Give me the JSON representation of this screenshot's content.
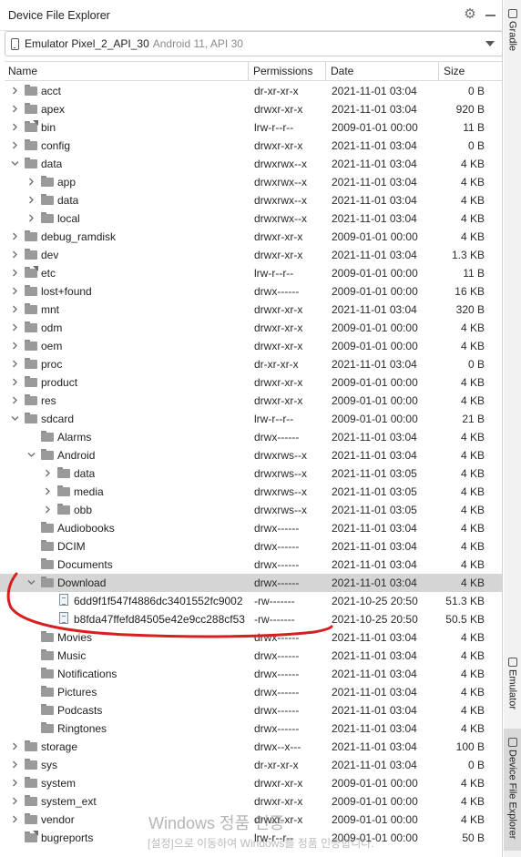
{
  "panel": {
    "title": "Device File Explorer"
  },
  "device": {
    "name": "Emulator Pixel_2_API_30",
    "info": "Android 11, API 30"
  },
  "columns": {
    "name": "Name",
    "permissions": "Permissions",
    "date": "Date",
    "size": "Size"
  },
  "sidebar": {
    "gradle": "Gradle",
    "emulator": "Emulator",
    "device_file_explorer": "Device File Explorer"
  },
  "watermark": {
    "line1": "Windows 정품 인증",
    "line2": "[설정]으로 이동하여 Windows를 정품 인증합니다."
  },
  "rows": [
    {
      "depth": 0,
      "arrow": "right",
      "type": "folder",
      "name": "acct",
      "perm": "dr-xr-xr-x",
      "date": "2021-11-01 03:04",
      "size": "0 B"
    },
    {
      "depth": 0,
      "arrow": "right",
      "type": "folder",
      "name": "apex",
      "perm": "drwxr-xr-x",
      "date": "2021-11-01 03:04",
      "size": "920 B"
    },
    {
      "depth": 0,
      "arrow": "right",
      "type": "link",
      "name": "bin",
      "perm": "lrw-r--r--",
      "date": "2009-01-01 00:00",
      "size": "11 B"
    },
    {
      "depth": 0,
      "arrow": "right",
      "type": "folder",
      "name": "config",
      "perm": "drwxr-xr-x",
      "date": "2021-11-01 03:04",
      "size": "0 B"
    },
    {
      "depth": 0,
      "arrow": "down",
      "type": "folder",
      "name": "data",
      "perm": "drwxrwx--x",
      "date": "2021-11-01 03:04",
      "size": "4 KB"
    },
    {
      "depth": 1,
      "arrow": "right",
      "type": "folder",
      "name": "app",
      "perm": "drwxrwx--x",
      "date": "2021-11-01 03:04",
      "size": "4 KB"
    },
    {
      "depth": 1,
      "arrow": "right",
      "type": "folder",
      "name": "data",
      "perm": "drwxrwx--x",
      "date": "2021-11-01 03:04",
      "size": "4 KB"
    },
    {
      "depth": 1,
      "arrow": "right",
      "type": "folder",
      "name": "local",
      "perm": "drwxrwx--x",
      "date": "2021-11-01 03:04",
      "size": "4 KB"
    },
    {
      "depth": 0,
      "arrow": "right",
      "type": "folder",
      "name": "debug_ramdisk",
      "perm": "drwxr-xr-x",
      "date": "2009-01-01 00:00",
      "size": "4 KB"
    },
    {
      "depth": 0,
      "arrow": "right",
      "type": "folder",
      "name": "dev",
      "perm": "drwxr-xr-x",
      "date": "2021-11-01 03:04",
      "size": "1.3 KB"
    },
    {
      "depth": 0,
      "arrow": "right",
      "type": "link",
      "name": "etc",
      "perm": "lrw-r--r--",
      "date": "2009-01-01 00:00",
      "size": "11 B"
    },
    {
      "depth": 0,
      "arrow": "right",
      "type": "folder",
      "name": "lost+found",
      "perm": "drwx------",
      "date": "2009-01-01 00:00",
      "size": "16 KB"
    },
    {
      "depth": 0,
      "arrow": "right",
      "type": "folder",
      "name": "mnt",
      "perm": "drwxr-xr-x",
      "date": "2021-11-01 03:04",
      "size": "320 B"
    },
    {
      "depth": 0,
      "arrow": "right",
      "type": "folder",
      "name": "odm",
      "perm": "drwxr-xr-x",
      "date": "2009-01-01 00:00",
      "size": "4 KB"
    },
    {
      "depth": 0,
      "arrow": "right",
      "type": "folder",
      "name": "oem",
      "perm": "drwxr-xr-x",
      "date": "2009-01-01 00:00",
      "size": "4 KB"
    },
    {
      "depth": 0,
      "arrow": "right",
      "type": "folder",
      "name": "proc",
      "perm": "dr-xr-xr-x",
      "date": "2021-11-01 03:04",
      "size": "0 B"
    },
    {
      "depth": 0,
      "arrow": "right",
      "type": "folder",
      "name": "product",
      "perm": "drwxr-xr-x",
      "date": "2009-01-01 00:00",
      "size": "4 KB"
    },
    {
      "depth": 0,
      "arrow": "right",
      "type": "folder",
      "name": "res",
      "perm": "drwxr-xr-x",
      "date": "2009-01-01 00:00",
      "size": "4 KB"
    },
    {
      "depth": 0,
      "arrow": "down",
      "type": "folder",
      "name": "sdcard",
      "perm": "lrw-r--r--",
      "date": "2009-01-01 00:00",
      "size": "21 B"
    },
    {
      "depth": 1,
      "arrow": "none",
      "type": "folder",
      "name": "Alarms",
      "perm": "drwx------",
      "date": "2021-11-01 03:04",
      "size": "4 KB"
    },
    {
      "depth": 1,
      "arrow": "down",
      "type": "folder",
      "name": "Android",
      "perm": "drwxrws--x",
      "date": "2021-11-01 03:04",
      "size": "4 KB"
    },
    {
      "depth": 2,
      "arrow": "right",
      "type": "folder",
      "name": "data",
      "perm": "drwxrws--x",
      "date": "2021-11-01 03:05",
      "size": "4 KB"
    },
    {
      "depth": 2,
      "arrow": "right",
      "type": "folder",
      "name": "media",
      "perm": "drwxrws--x",
      "date": "2021-11-01 03:05",
      "size": "4 KB"
    },
    {
      "depth": 2,
      "arrow": "right",
      "type": "folder",
      "name": "obb",
      "perm": "drwxrws--x",
      "date": "2021-11-01 03:05",
      "size": "4 KB"
    },
    {
      "depth": 1,
      "arrow": "none",
      "type": "folder",
      "name": "Audiobooks",
      "perm": "drwx------",
      "date": "2021-11-01 03:04",
      "size": "4 KB"
    },
    {
      "depth": 1,
      "arrow": "none",
      "type": "folder",
      "name": "DCIM",
      "perm": "drwx------",
      "date": "2021-11-01 03:04",
      "size": "4 KB"
    },
    {
      "depth": 1,
      "arrow": "none",
      "type": "folder",
      "name": "Documents",
      "perm": "drwx------",
      "date": "2021-11-01 03:04",
      "size": "4 KB"
    },
    {
      "depth": 1,
      "arrow": "down",
      "type": "folder",
      "name": "Download",
      "perm": "drwx------",
      "date": "2021-11-01 03:04",
      "size": "4 KB",
      "selected": true
    },
    {
      "depth": 2,
      "arrow": "none",
      "type": "file",
      "name": "6dd9f1f547f4886dc3401552fc9002",
      "perm": "-rw-------",
      "date": "2021-10-25 20:50",
      "size": "51.3 KB"
    },
    {
      "depth": 2,
      "arrow": "none",
      "type": "file",
      "name": "b8fda47ffefd84505e42e9cc288cf53",
      "perm": "-rw-------",
      "date": "2021-10-25 20:50",
      "size": "50.5 KB"
    },
    {
      "depth": 1,
      "arrow": "none",
      "type": "folder",
      "name": "Movies",
      "perm": "drwx------",
      "date": "2021-11-01 03:04",
      "size": "4 KB"
    },
    {
      "depth": 1,
      "arrow": "none",
      "type": "folder",
      "name": "Music",
      "perm": "drwx------",
      "date": "2021-11-01 03:04",
      "size": "4 KB"
    },
    {
      "depth": 1,
      "arrow": "none",
      "type": "folder",
      "name": "Notifications",
      "perm": "drwx------",
      "date": "2021-11-01 03:04",
      "size": "4 KB"
    },
    {
      "depth": 1,
      "arrow": "none",
      "type": "folder",
      "name": "Pictures",
      "perm": "drwx------",
      "date": "2021-11-01 03:04",
      "size": "4 KB"
    },
    {
      "depth": 1,
      "arrow": "none",
      "type": "folder",
      "name": "Podcasts",
      "perm": "drwx------",
      "date": "2021-11-01 03:04",
      "size": "4 KB"
    },
    {
      "depth": 1,
      "arrow": "none",
      "type": "folder",
      "name": "Ringtones",
      "perm": "drwx------",
      "date": "2021-11-01 03:04",
      "size": "4 KB"
    },
    {
      "depth": 0,
      "arrow": "right",
      "type": "folder",
      "name": "storage",
      "perm": "drwx--x---",
      "date": "2021-11-01 03:04",
      "size": "100 B"
    },
    {
      "depth": 0,
      "arrow": "right",
      "type": "folder",
      "name": "sys",
      "perm": "dr-xr-xr-x",
      "date": "2021-11-01 03:04",
      "size": "0 B"
    },
    {
      "depth": 0,
      "arrow": "right",
      "type": "folder",
      "name": "system",
      "perm": "drwxr-xr-x",
      "date": "2009-01-01 00:00",
      "size": "4 KB"
    },
    {
      "depth": 0,
      "arrow": "right",
      "type": "folder",
      "name": "system_ext",
      "perm": "drwxr-xr-x",
      "date": "2009-01-01 00:00",
      "size": "4 KB"
    },
    {
      "depth": 0,
      "arrow": "right",
      "type": "folder",
      "name": "vendor",
      "perm": "drwxr-xr-x",
      "date": "2009-01-01 00:00",
      "size": "4 KB"
    },
    {
      "depth": 0,
      "arrow": "none",
      "type": "link",
      "name": "bugreports",
      "perm": "lrw-r--r--",
      "date": "2009-01-01 00:00",
      "size": "50 B"
    }
  ]
}
